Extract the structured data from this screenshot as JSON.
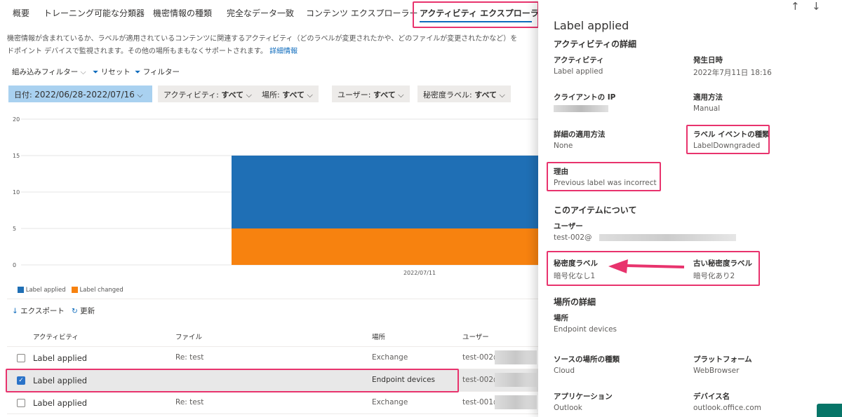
{
  "tabs": [
    {
      "label": "概要"
    },
    {
      "label": "トレーニング可能な分類器"
    },
    {
      "label": "機密情報の種類"
    },
    {
      "label": "完全なデータ一致"
    },
    {
      "label": "コンテンツ エクスプローラー"
    },
    {
      "label": "アクティビティ エクスプローラー"
    }
  ],
  "description": {
    "line1": "機密情報が含まれているか、ラベルが適用されているコンテンツに関連するアクティビティ（どのラベルが変更されたかや、どのファイルが変更されたかなど）を",
    "line2": "ドポイント デバイスで監視されます。その他の場所もまもなくサポートされます。",
    "link": "詳細情報"
  },
  "toolbar": {
    "builtin_filter": "組み込みフィルター",
    "reset": "リセット",
    "filter": "フィルター"
  },
  "filters": [
    {
      "key": "日付:",
      "value": "2022/06/28-2022/07/16"
    },
    {
      "key": "アクティビティ:",
      "value": "すべて"
    },
    {
      "key": "場所:",
      "value": "すべて"
    },
    {
      "key": "ユーザー:",
      "value": "すべて"
    },
    {
      "key": "秘密度ラベル:",
      "value": "すべて"
    }
  ],
  "chart_data": {
    "type": "bar",
    "stacked": true,
    "categories": [
      "2022/07/11"
    ],
    "series": [
      {
        "name": "Label applied",
        "values": [
          10
        ],
        "color": "#1f6fb5"
      },
      {
        "name": "Label changed",
        "values": [
          5
        ],
        "color": "#f7820f"
      }
    ],
    "yticks": [
      0,
      5,
      10,
      15,
      20
    ],
    "ylim": [
      0,
      20
    ],
    "legend": "bottom-left"
  },
  "actions": {
    "export": "エクスポート",
    "refresh": "更新"
  },
  "table": {
    "headers": [
      "アクティビティ",
      "ファイル",
      "場所",
      "ユーザー"
    ],
    "rows": [
      {
        "activity": "Label applied",
        "file": "Re: test",
        "location": "Exchange",
        "user": "test-002@",
        "checked": false
      },
      {
        "activity": "Label applied",
        "file": "",
        "location": "Endpoint devices",
        "user": "test-002@",
        "checked": true
      },
      {
        "activity": "Label applied",
        "file": "Re: test",
        "location": "Exchange",
        "user": "test-001@",
        "checked": false
      }
    ]
  },
  "panel": {
    "title": "Label applied",
    "details_heading": "アクティビティの詳細",
    "activity_label": "アクティビティ",
    "activity": "Label applied",
    "date_label": "発生日時",
    "date": "2022年7月11日 18:16",
    "ip_label": "クライアントの IP",
    "method_label": "適用方法",
    "method": "Manual",
    "detail_method_label": "詳細の適用方法",
    "detail_method": "None",
    "event_type_label": "ラベル イベントの種類",
    "event_type": "LabelDowngraded",
    "reason_label": "理由",
    "reason": "Previous label was incorrect",
    "item_heading": "このアイテムについて",
    "user_label": "ユーザー",
    "user": "test-002@",
    "sens_label": "秘密度ラベル",
    "sens": "暗号化なし1",
    "old_sens_label": "古い秘密度ラベル",
    "old_sens": "暗号化あり2",
    "location_heading": "場所の詳細",
    "location_label": "場所",
    "location": "Endpoint devices",
    "source_type_label": "ソースの場所の種類",
    "source_type": "Cloud",
    "platform_label": "プラットフォーム",
    "platform": "WebBrowser",
    "app_label": "アプリケーション",
    "app": "Outlook",
    "device_label": "デバイス名",
    "device": "outlook.office.com"
  }
}
